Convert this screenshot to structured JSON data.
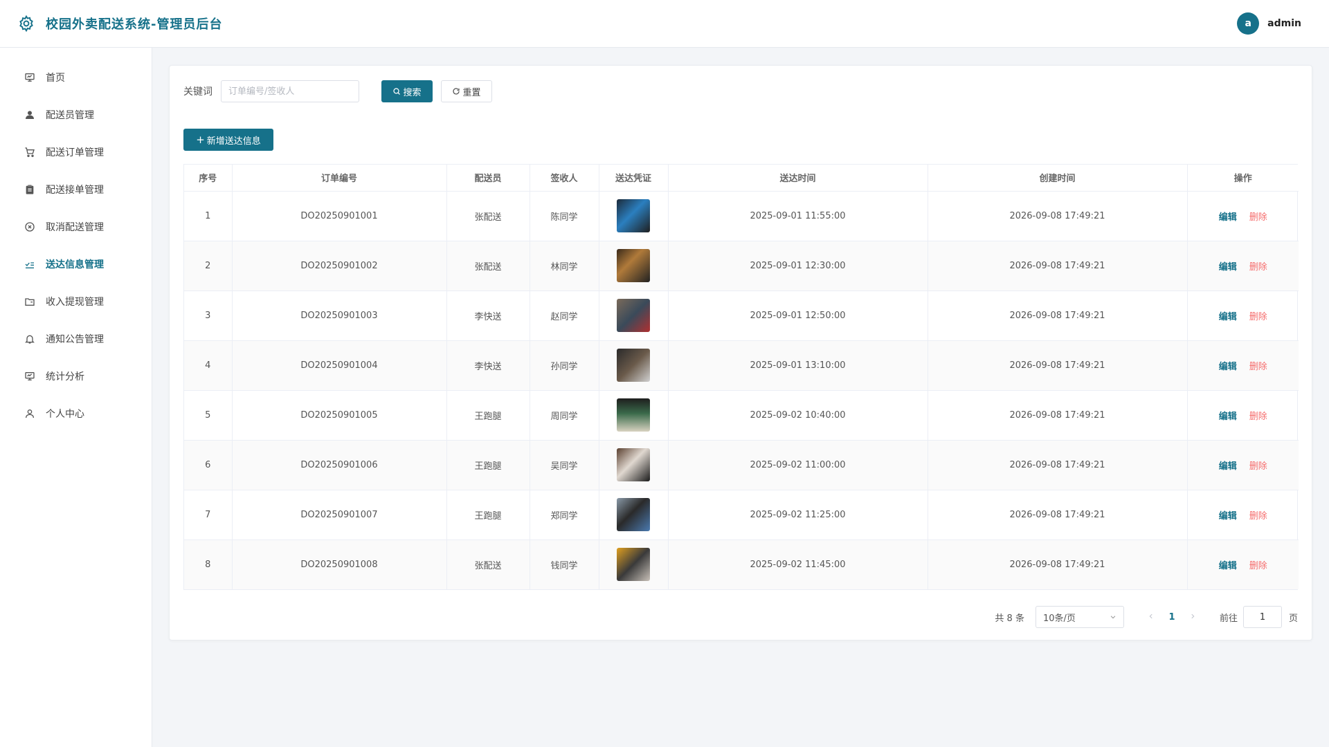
{
  "header": {
    "title": "校园外卖配送系统-管理员后台",
    "avatar_letter": "a",
    "username": "admin"
  },
  "sidebar": {
    "items": [
      {
        "label": "首页",
        "icon": "monitor-icon"
      },
      {
        "label": "配送员管理",
        "icon": "user-icon"
      },
      {
        "label": "配送订单管理",
        "icon": "cart-icon"
      },
      {
        "label": "配送接单管理",
        "icon": "clipboard-icon"
      },
      {
        "label": "取消配送管理",
        "icon": "circle-x-icon"
      },
      {
        "label": "送达信息管理",
        "icon": "checklist-icon",
        "active": true
      },
      {
        "label": "收入提现管理",
        "icon": "folder-icon"
      },
      {
        "label": "通知公告管理",
        "icon": "bell-icon"
      },
      {
        "label": "统计分析",
        "icon": "chart-icon"
      },
      {
        "label": "个人中心",
        "icon": "person-icon"
      }
    ]
  },
  "search": {
    "label": "关键词",
    "placeholder": "订单编号/签收人",
    "search_btn": "搜索",
    "reset_btn": "重置"
  },
  "add_btn": "新增送达信息",
  "table": {
    "columns": [
      "序号",
      "订单编号",
      "配送员",
      "签收人",
      "送达凭证",
      "送达时间",
      "创建时间",
      "操作"
    ],
    "edit_label": "编辑",
    "delete_label": "删除",
    "rows": [
      {
        "no": "1",
        "order": "DO20250901001",
        "courier": "张配送",
        "receiver": "陈同学",
        "time": "2025-09-01 11:55:00",
        "created": "2026-09-08 17:49:21"
      },
      {
        "no": "2",
        "order": "DO20250901002",
        "courier": "张配送",
        "receiver": "林同学",
        "time": "2025-09-01 12:30:00",
        "created": "2026-09-08 17:49:21"
      },
      {
        "no": "3",
        "order": "DO20250901003",
        "courier": "李快送",
        "receiver": "赵同学",
        "time": "2025-09-01 12:50:00",
        "created": "2026-09-08 17:49:21"
      },
      {
        "no": "4",
        "order": "DO20250901004",
        "courier": "李快送",
        "receiver": "孙同学",
        "time": "2025-09-01 13:10:00",
        "created": "2026-09-08 17:49:21"
      },
      {
        "no": "5",
        "order": "DO20250901005",
        "courier": "王跑腿",
        "receiver": "周同学",
        "time": "2025-09-02 10:40:00",
        "created": "2026-09-08 17:49:21"
      },
      {
        "no": "6",
        "order": "DO20250901006",
        "courier": "王跑腿",
        "receiver": "吴同学",
        "time": "2025-09-02 11:00:00",
        "created": "2026-09-08 17:49:21"
      },
      {
        "no": "7",
        "order": "DO20250901007",
        "courier": "王跑腿",
        "receiver": "郑同学",
        "time": "2025-09-02 11:25:00",
        "created": "2026-09-08 17:49:21"
      },
      {
        "no": "8",
        "order": "DO20250901008",
        "courier": "张配送",
        "receiver": "钱同学",
        "time": "2025-09-02 11:45:00",
        "created": "2026-09-08 17:49:21"
      }
    ]
  },
  "pagination": {
    "total": "共 8 条",
    "page_size": "10条/页",
    "current": "1",
    "goto_label": "前往",
    "goto_value": "1",
    "page_label": "页"
  },
  "colors": {
    "accent": "#16718a",
    "danger": "#f56c6c"
  }
}
